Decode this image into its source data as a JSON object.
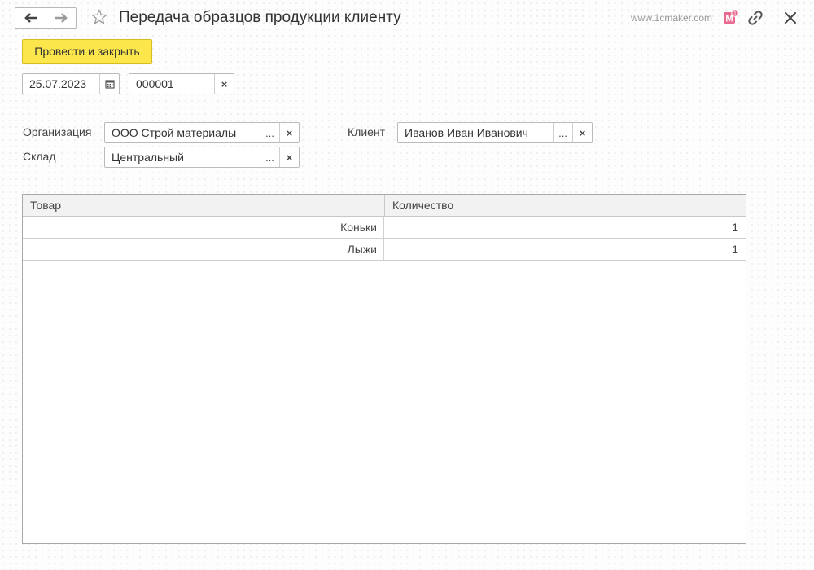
{
  "header": {
    "title": "Передача образцов продукции клиенту",
    "site": "www.1cmaker.com",
    "badge_letter": "M",
    "badge_count": "1"
  },
  "toolbar": {
    "post_close_label": "Провести и закрыть"
  },
  "document": {
    "date": "25.07.2023",
    "number": "000001"
  },
  "form": {
    "organization_label": "Организация",
    "organization_value": "ООО Строй материалы",
    "warehouse_label": "Склад",
    "warehouse_value": "Центральный",
    "client_label": "Клиент",
    "client_value": "Иванов Иван Иванович",
    "choose_glyph": "...",
    "clear_glyph": "×"
  },
  "table": {
    "columns": [
      "Товар",
      "Количество"
    ],
    "rows": [
      {
        "product": "Коньки",
        "quantity": "1"
      },
      {
        "product": "Лыжи",
        "quantity": "1"
      }
    ]
  },
  "colors": {
    "accent_button": "#fbe64b",
    "badge": "#e86a8e"
  }
}
